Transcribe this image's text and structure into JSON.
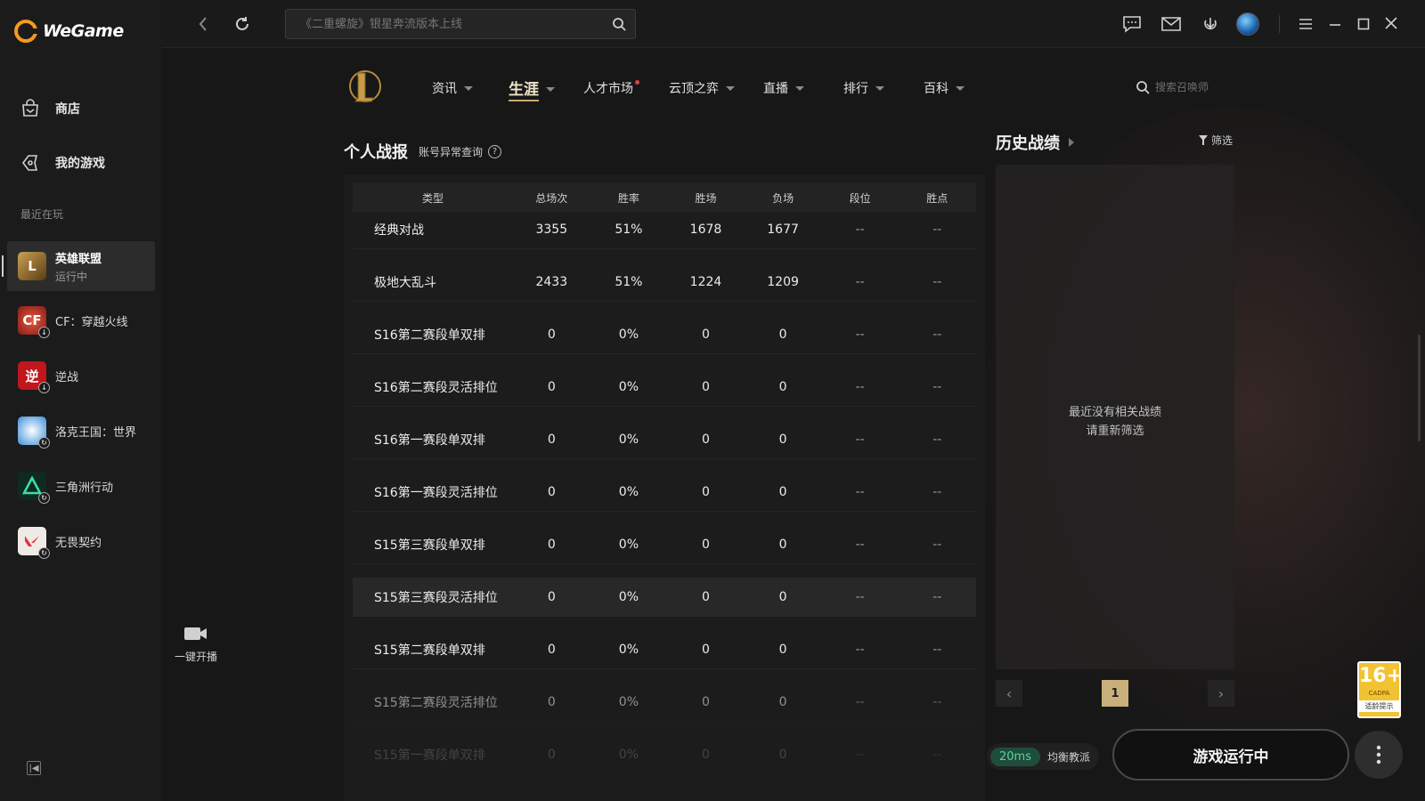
{
  "app": {
    "name": "WeGame"
  },
  "sidebar": {
    "nav": [
      {
        "label": "商店",
        "icon": "store-icon"
      },
      {
        "label": "我的游戏",
        "icon": "games-icon"
      }
    ],
    "recent_label": "最近在玩",
    "games": [
      {
        "name": "英雄联盟",
        "status": "运行中",
        "color": "#7a5a20"
      },
      {
        "name": "CF：穿越火线",
        "color": "#b22a2a"
      },
      {
        "name": "逆战",
        "color": "#c0161c"
      },
      {
        "name": "洛克王国：世界",
        "color": "#3a8dd8"
      },
      {
        "name": "三角洲行动",
        "color": "#1e6a52"
      },
      {
        "name": "无畏契约",
        "color": "#c9323c"
      }
    ]
  },
  "topbar": {
    "search_placeholder": "《二重螺旋》银星奔流版本上线"
  },
  "lol_nav": {
    "items": [
      {
        "label": "资讯",
        "caret": true
      },
      {
        "label": "生涯",
        "caret": true,
        "active": true
      },
      {
        "label": "人才市场",
        "dot": true
      },
      {
        "label": "云顶之弈",
        "caret": true
      },
      {
        "label": "直播",
        "caret": true
      },
      {
        "label": "排行",
        "caret": true
      },
      {
        "label": "百科",
        "caret": true
      }
    ],
    "search_placeholder": "搜索召唤师"
  },
  "stats": {
    "title": "个人战报",
    "anomaly_link": "账号异常查询",
    "help_symbol": "?",
    "columns": [
      "类型",
      "总场次",
      "胜率",
      "胜场",
      "负场",
      "段位",
      "胜点"
    ],
    "rows": [
      [
        "经典对战",
        "3355",
        "51%",
        "1678",
        "1677",
        "--",
        "--"
      ],
      [
        "极地大乱斗",
        "2433",
        "51%",
        "1224",
        "1209",
        "--",
        "--"
      ],
      [
        "S16第二赛段单双排",
        "0",
        "0%",
        "0",
        "0",
        "--",
        "--"
      ],
      [
        "S16第二赛段灵活排位",
        "0",
        "0%",
        "0",
        "0",
        "--",
        "--"
      ],
      [
        "S16第一赛段单双排",
        "0",
        "0%",
        "0",
        "0",
        "--",
        "--"
      ],
      [
        "S16第一赛段灵活排位",
        "0",
        "0%",
        "0",
        "0",
        "--",
        "--"
      ],
      [
        "S15第三赛段单双排",
        "0",
        "0%",
        "0",
        "0",
        "--",
        "--"
      ],
      [
        "S15第三赛段灵活排位",
        "0",
        "0%",
        "0",
        "0",
        "--",
        "--"
      ],
      [
        "S15第二赛段单双排",
        "0",
        "0%",
        "0",
        "0",
        "--",
        "--"
      ],
      [
        "S15第二赛段灵活排位",
        "0",
        "0%",
        "0",
        "0",
        "--",
        "--"
      ],
      [
        "S15第一赛段单双排",
        "0",
        "0%",
        "0",
        "0",
        "--",
        "--"
      ]
    ],
    "highlighted_row": 7
  },
  "broadcast": {
    "label": "一键开播"
  },
  "history": {
    "title": "历史战绩",
    "filter_label": "筛选",
    "empty_line1": "最近没有相关战绩",
    "empty_line2": "请重新筛选",
    "page": "1"
  },
  "footer": {
    "latency": "20ms",
    "server": "均衡教派",
    "play_label": "游戏运行中"
  },
  "age_rating": {
    "number": "16+",
    "sub": "CADPA",
    "label": "适龄提示"
  }
}
